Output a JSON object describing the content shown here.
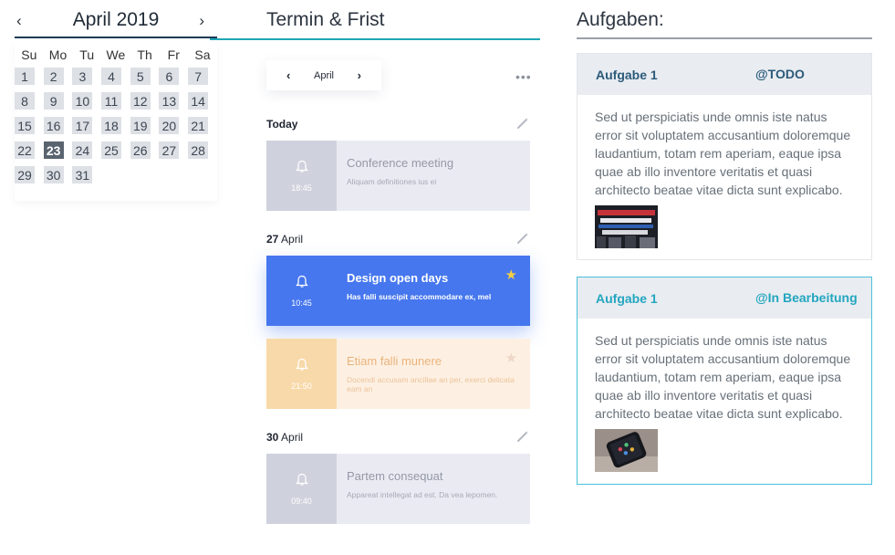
{
  "calendar": {
    "title": "April 2019",
    "prev_icon": "‹",
    "next_icon": "›",
    "weekdays": [
      "Su",
      "Mo",
      "Tu",
      "We",
      "Th",
      "Fr",
      "Sa"
    ],
    "days": [
      "1",
      "2",
      "3",
      "4",
      "5",
      "6",
      "7",
      "8",
      "9",
      "10",
      "11",
      "12",
      "13",
      "14",
      "15",
      "16",
      "17",
      "18",
      "19",
      "20",
      "21",
      "22",
      "23",
      "24",
      "25",
      "26",
      "27",
      "28",
      "29",
      "30",
      "31"
    ],
    "selected_day": "23"
  },
  "schedule": {
    "title": "Termin & Frist",
    "month_label": "April",
    "prev_icon": "‹",
    "next_icon": "›",
    "more_icon": "•••",
    "sections": [
      {
        "label_bold": "Today",
        "label_rest": ""
      },
      {
        "label_bold": "27",
        "label_rest": " April"
      },
      {
        "label_bold": "30",
        "label_rest": " April"
      }
    ],
    "events": [
      {
        "title": "Conference meeting",
        "desc": "Aliquam definitiones ius ei",
        "time": "18:45",
        "style": "grey"
      },
      {
        "title": "Design open days",
        "desc": "Has falli suscipit accommodare ex, mel",
        "time": "10:45",
        "style": "blue"
      },
      {
        "title": "Etiam falli munere",
        "desc": "Docendi accusam ancillae an per, exerci delicata eam an",
        "time": "21:50",
        "style": "orange"
      },
      {
        "title": "Partem consequat",
        "desc": "Appareat intellegat ad est. Da vea lepomen.",
        "time": "09:40",
        "style": "grey"
      }
    ]
  },
  "tasks": {
    "title": "Aufgaben:",
    "cards": [
      {
        "name": "Aufgabe 1",
        "status": "@TODO",
        "text": "Sed ut perspiciatis unde omnis iste natus error sit voluptatem accusantium doloremque laudantium, totam rem aperiam, eaque ipsa quae ab illo inventore veritatis et quasi architecto beatae vitae dicta sunt explicabo.",
        "accent": "#2b5a7a"
      },
      {
        "name": "Aufgabe 1",
        "status": "@In Bearbeitung",
        "text": "Sed ut perspiciatis unde omnis iste natus error sit voluptatem accusantium doloremque laudantium, totam rem aperiam, eaque ipsa quae ab illo inventore veritatis et quasi architecto beatae vitae dicta sunt explicabo.",
        "accent": "#22a6bf"
      }
    ]
  },
  "colors": {
    "calendar_rule": "#1b3a56",
    "schedule_rule": "#1fa6b4",
    "event_blue": "#4677ee",
    "event_orange": "#f8d9a9",
    "event_grey": "#cfd2dd",
    "star_active": "#f4cf43"
  }
}
